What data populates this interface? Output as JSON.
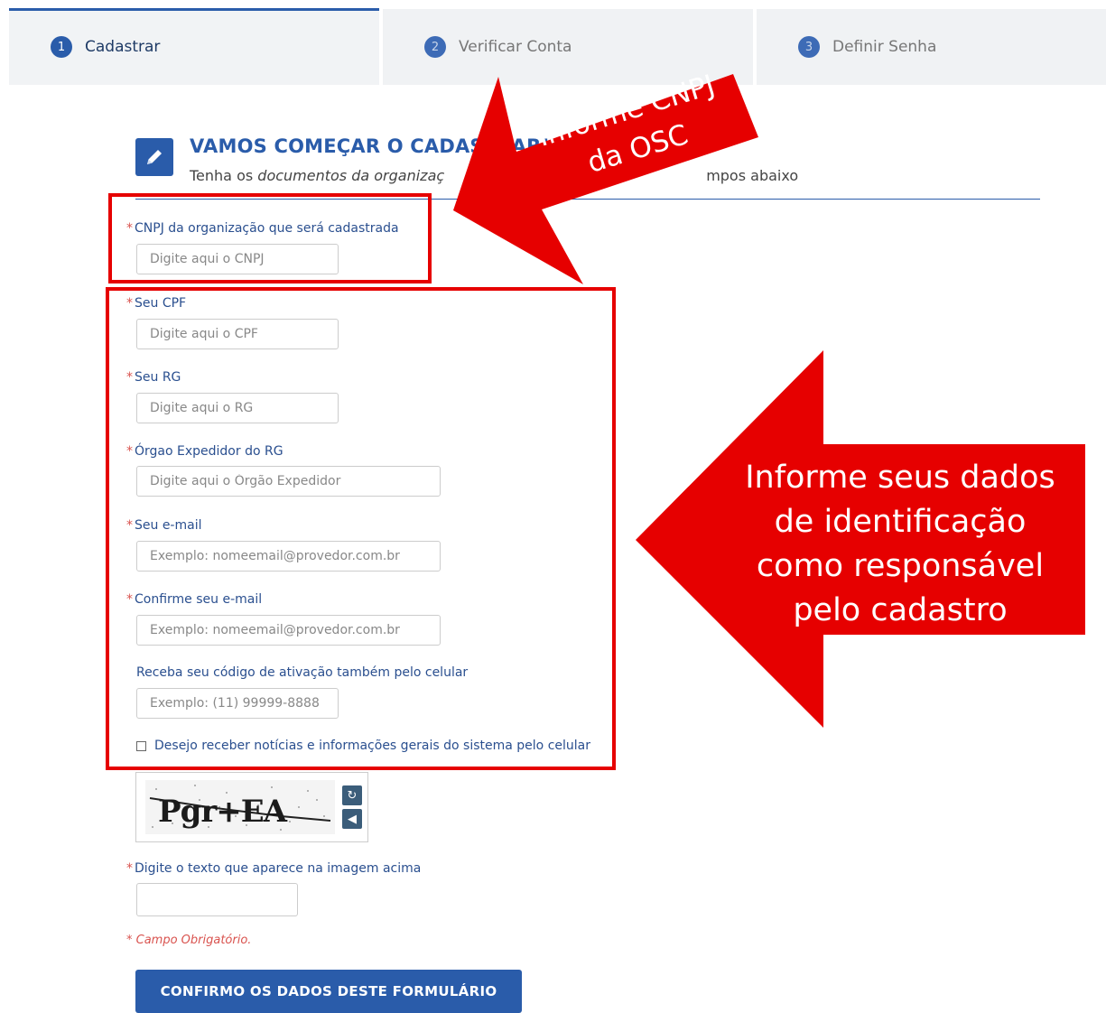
{
  "steps": [
    {
      "number": "1",
      "label": "Cadastrar"
    },
    {
      "number": "2",
      "label": "Verificar Conta"
    },
    {
      "number": "3",
      "label": "Definir Senha"
    }
  ],
  "header": {
    "title": "VAMOS COMEÇAR O CADASTRAR!",
    "subtitle_prefix": "Tenha os ",
    "subtitle_em": "documentos da organizaç",
    "subtitle_suffix": "mpos abaixo"
  },
  "form": {
    "required_mark": "*",
    "cnpj": {
      "label": "CNPJ da organização que será cadastrada",
      "placeholder": "Digite aqui o CNPJ",
      "value": ""
    },
    "cpf": {
      "label": "Seu CPF",
      "placeholder": "Digite aqui o CPF",
      "value": ""
    },
    "rg": {
      "label": "Seu RG",
      "placeholder": "Digite aqui o RG",
      "value": ""
    },
    "orgao": {
      "label": "Órgao Expedidor do RG",
      "placeholder": "Digite aqui o Órgão Expedidor",
      "value": ""
    },
    "email": {
      "label": "Seu e-mail",
      "placeholder": "Exemplo: nomeemail@provedor.com.br",
      "value": ""
    },
    "email_confirm": {
      "label": "Confirme seu e-mail",
      "placeholder": "Exemplo: nomeemail@provedor.com.br",
      "value": ""
    },
    "phone": {
      "label": "Receba seu código de ativação também pelo celular",
      "placeholder": "Exemplo: (11) 99999-8888",
      "value": ""
    },
    "news_checkbox": {
      "label": "Desejo receber notícias e informações gerais do sistema pelo celular",
      "checked": false
    },
    "captcha": {
      "image_text": "Pgr+EA",
      "refresh_icon": "refresh-icon",
      "audio_icon": "audio-icon"
    },
    "captcha_input": {
      "label": "Digite o texto que aparece na imagem acima",
      "value": ""
    },
    "required_note": "* Campo Obrigatório.",
    "submit_label": "CONFIRMO OS DADOS DESTE FORMULÁRIO"
  },
  "annotations": {
    "cnpj_callout_line1": "Informe CNPJ",
    "cnpj_callout_line2": "da OSC",
    "identity_callout": [
      "Informe seus dados",
      "de identificação",
      "como responsável",
      "pelo cadastro"
    ],
    "color": "#e60000"
  },
  "colors": {
    "brand": "#2a5caa",
    "required": "#d9534f",
    "annotation": "#e60000"
  }
}
